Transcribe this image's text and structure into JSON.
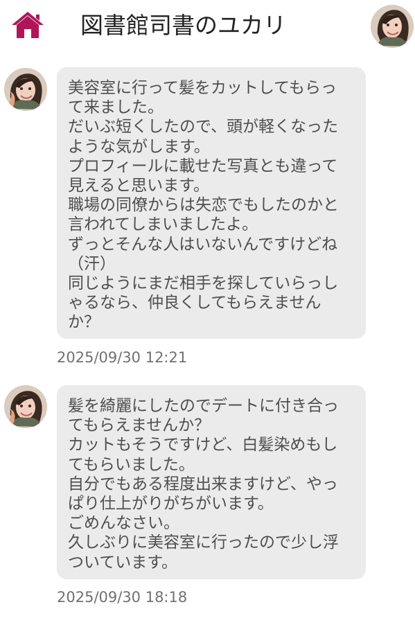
{
  "header": {
    "title": "図書館司書のユカリ",
    "home_icon": "home-icon",
    "avatar_icon": "profile-avatar"
  },
  "colors": {
    "home_icon": "#B0155A",
    "bubble_bg": "#EBEBEB",
    "text": "#4E4E4E",
    "timestamp": "#707070"
  },
  "messages": [
    {
      "text": "美容室に行って髪をカットしてもらっ\nて来ました。\nだいぶ短くしたので、頭が軽くなった\nような気がします。\nプロフィールに載せた写真とも違って\n見えると思います。\n職場の同僚からは失恋でもしたのかと\n言われてしまいましたよ。\nずっとそんな人はいないんですけどね\n（汗）\n同じようにまだ相手を探していらっし\nゃるなら、仲良くしてもらえません\nか？",
      "timestamp": "2025/09/30 12:21"
    },
    {
      "text": "髪を綺麗にしたのでデートに付き合っ\nてもらえませんか？\nカットもそうですけど、白髪染めもし\nてもらいました。\n自分でもある程度出来ますけど、やっ\nぱり仕上がりがちがいます。\nごめんなさい。\n久しぶりに美容室に行ったので少し浮\nついています。",
      "timestamp": "2025/09/30 18:18"
    }
  ]
}
